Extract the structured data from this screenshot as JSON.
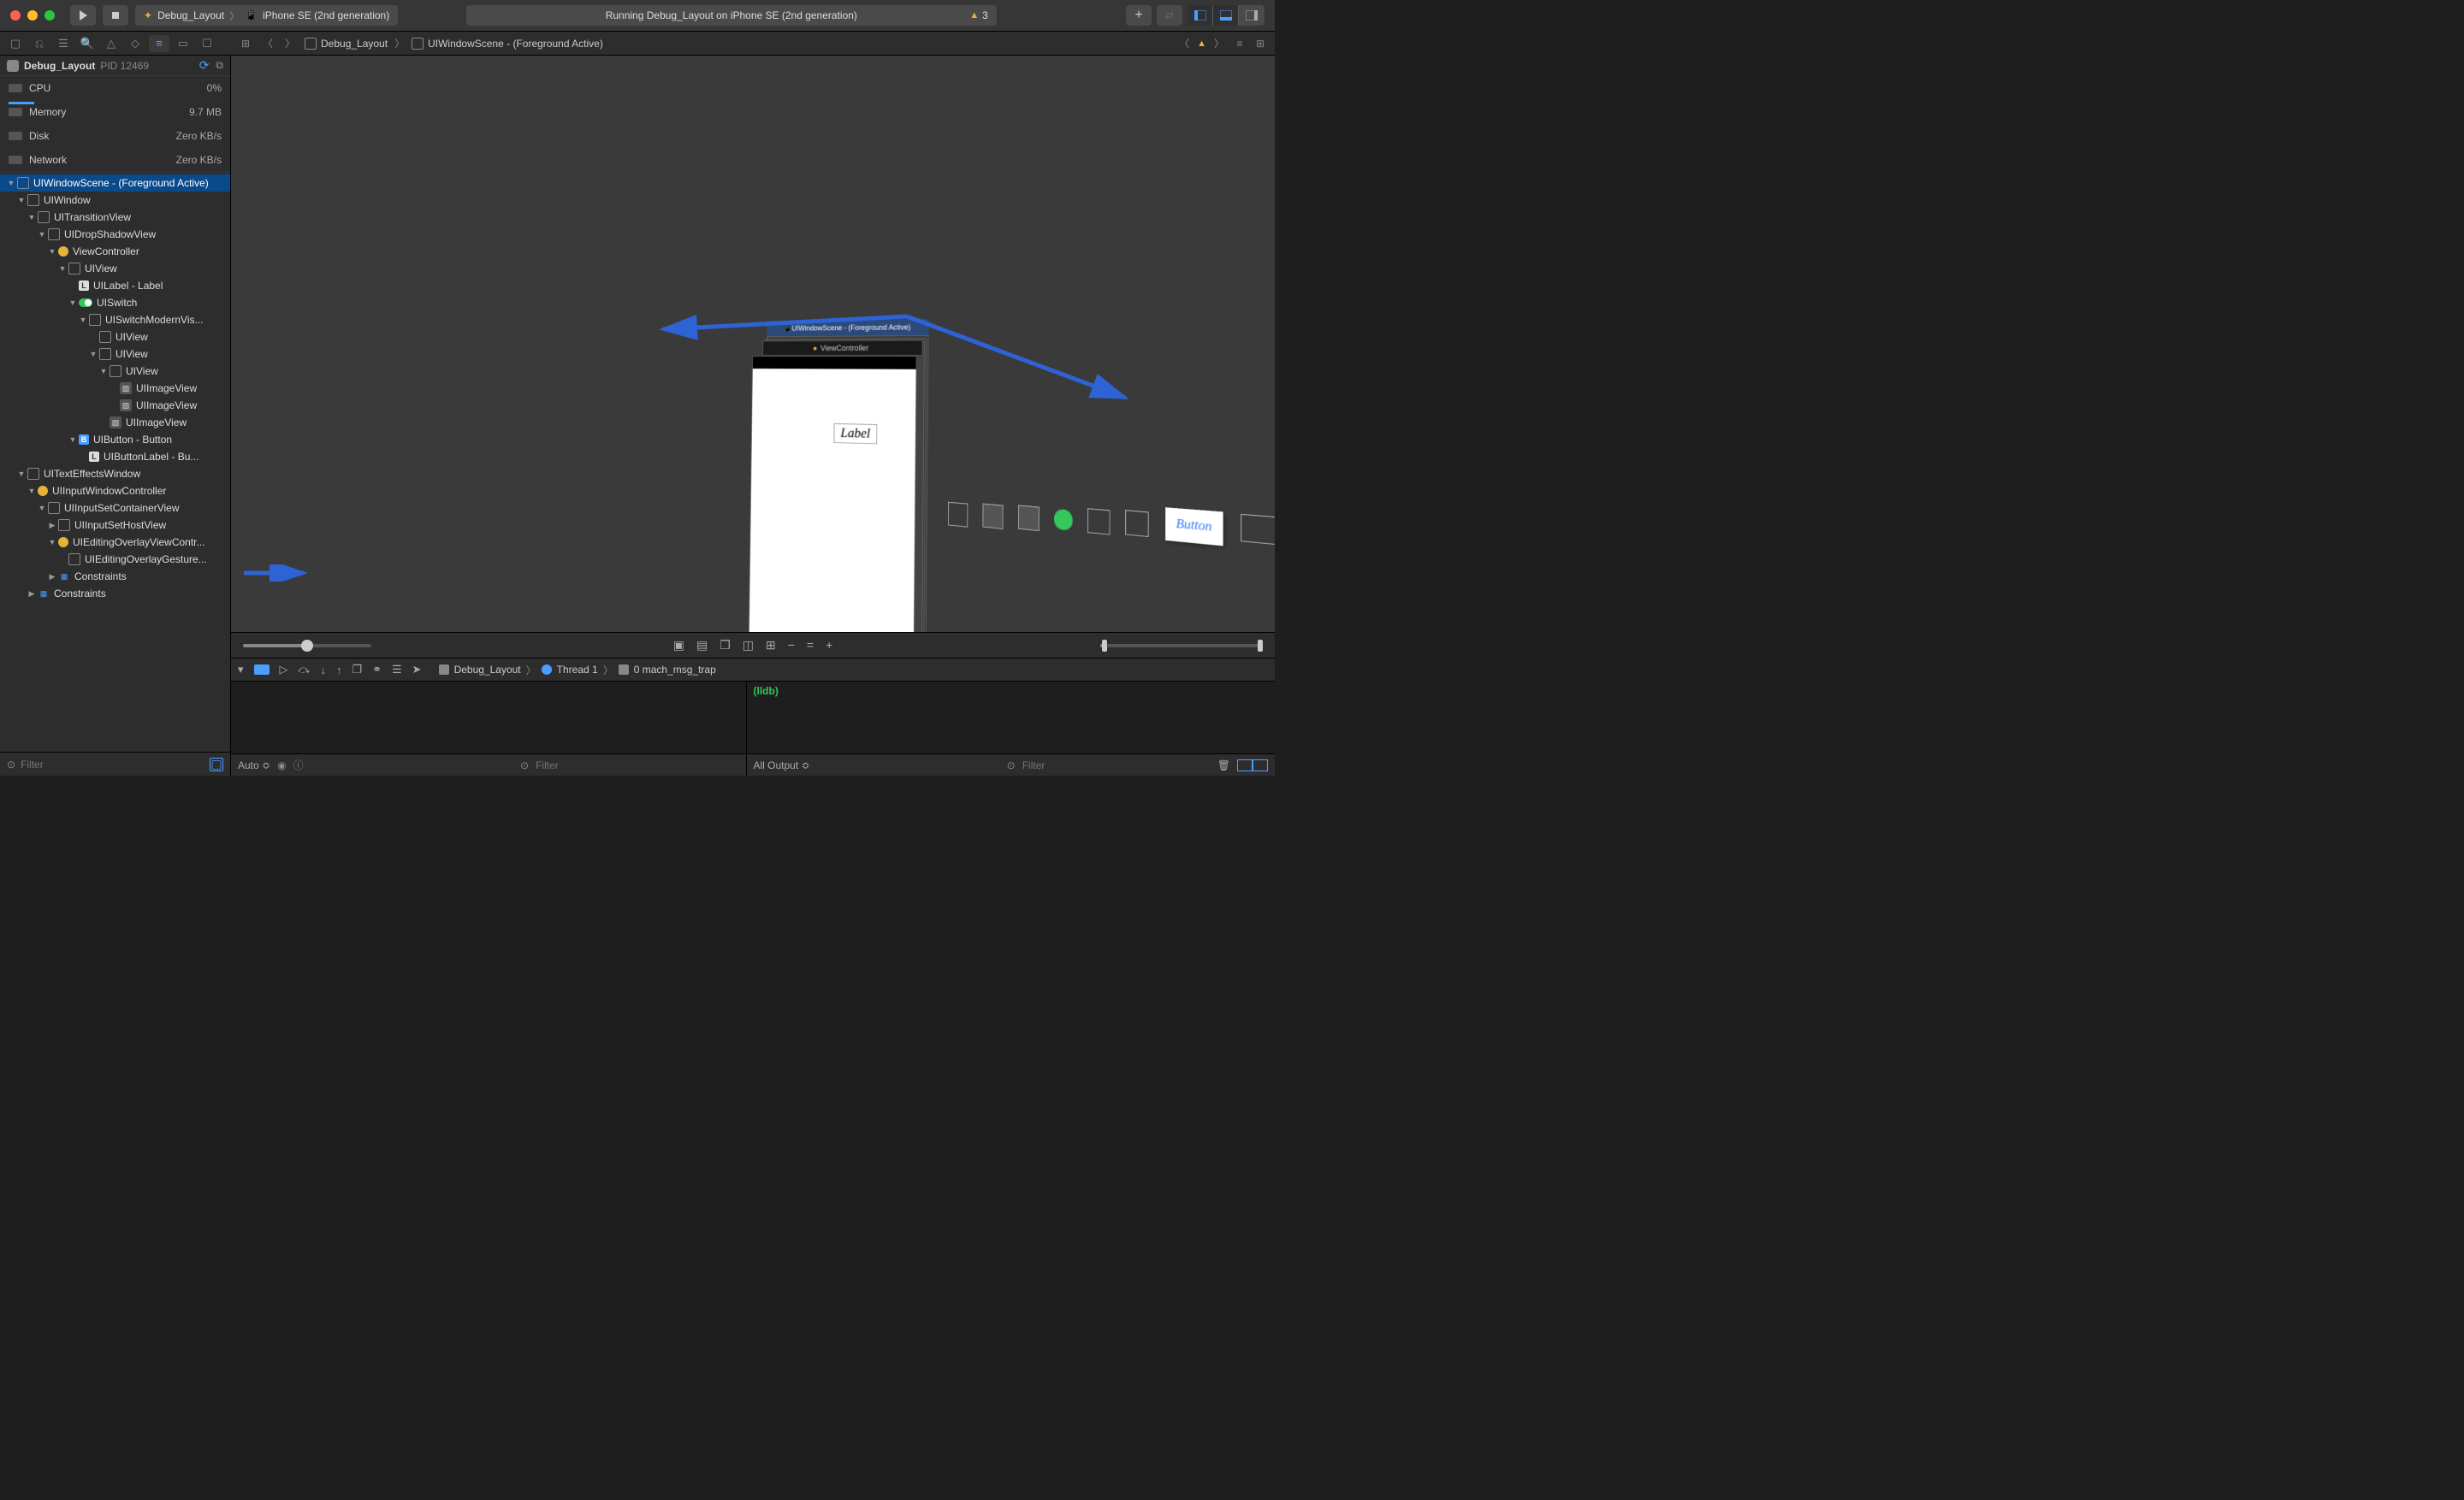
{
  "titlebar": {
    "scheme_target": "Debug_Layout",
    "scheme_device": "iPhone SE (2nd generation)",
    "status_text": "Running Debug_Layout on iPhone SE (2nd generation)",
    "warning_count": "3"
  },
  "sidebar": {
    "process_name": "Debug_Layout",
    "pid_label": "PID 12469",
    "gauges": {
      "cpu": {
        "label": "CPU",
        "value": "0%"
      },
      "memory": {
        "label": "Memory",
        "value": "9.7 MB"
      },
      "disk": {
        "label": "Disk",
        "value": "Zero KB/s"
      },
      "network": {
        "label": "Network",
        "value": "Zero KB/s"
      }
    },
    "tree": [
      {
        "indent": 0,
        "icon": "box",
        "text": "UIWindowScene - (Foreground Active)",
        "selected": true
      },
      {
        "indent": 1,
        "icon": "box",
        "text": "UIWindow"
      },
      {
        "indent": 2,
        "icon": "box",
        "text": "UITransitionView"
      },
      {
        "indent": 3,
        "icon": "box",
        "text": "UIDropShadowView"
      },
      {
        "indent": 4,
        "icon": "vc",
        "text": "ViewController"
      },
      {
        "indent": 5,
        "icon": "box",
        "text": "UIView"
      },
      {
        "indent": 6,
        "icon": "label",
        "text": "UILabel - Label",
        "leaf": true
      },
      {
        "indent": 6,
        "icon": "switch",
        "text": "UISwitch"
      },
      {
        "indent": 7,
        "icon": "box",
        "text": "UISwitchModernVis..."
      },
      {
        "indent": 8,
        "icon": "box",
        "text": "UIView",
        "leaf": true
      },
      {
        "indent": 8,
        "icon": "box",
        "text": "UIView"
      },
      {
        "indent": 9,
        "icon": "box",
        "text": "UIView"
      },
      {
        "indent": 10,
        "icon": "image",
        "text": "UIImageView",
        "leaf": true
      },
      {
        "indent": 10,
        "icon": "image",
        "text": "UIImageView",
        "leaf": true
      },
      {
        "indent": 9,
        "icon": "image",
        "text": "UIImageView",
        "leaf": true
      },
      {
        "indent": 6,
        "icon": "button",
        "text": "UIButton - Button"
      },
      {
        "indent": 7,
        "icon": "label",
        "text": "UIButtonLabel - Bu...",
        "leaf": true
      },
      {
        "indent": 1,
        "icon": "box",
        "text": "UITextEffectsWindow"
      },
      {
        "indent": 2,
        "icon": "vc",
        "text": "UIInputWindowController"
      },
      {
        "indent": 3,
        "icon": "box",
        "text": "UIInputSetContainerView"
      },
      {
        "indent": 4,
        "icon": "box",
        "text": "UIInputSetHostView",
        "closed": true
      },
      {
        "indent": 4,
        "icon": "vc",
        "text": "UIEditingOverlayViewContr..."
      },
      {
        "indent": 5,
        "icon": "box",
        "text": "UIEditingOverlayGesture...",
        "leaf": true
      },
      {
        "indent": 4,
        "icon": "constraints",
        "text": "Constraints",
        "closed": true
      },
      {
        "indent": 2,
        "icon": "constraints",
        "text": "Constraints",
        "closed": true
      }
    ],
    "filter_placeholder": "Filter"
  },
  "breadcrumb": {
    "items": [
      "Debug_Layout",
      "UIWindowScene - (Foreground Active)"
    ]
  },
  "canvas": {
    "scene_title": "UIWindowScene - (Foreground Active)",
    "vc_title": "ViewController",
    "label_text": "Label",
    "button_text": "Button"
  },
  "debugbar": {
    "crumbs": {
      "app": "Debug_Layout",
      "thread": "Thread 1",
      "frame": "0 mach_msg_trap"
    }
  },
  "console": {
    "prompt": "(lldb)",
    "left_mode": "Auto",
    "right_mode": "All Output",
    "filter_placeholder": "Filter"
  }
}
